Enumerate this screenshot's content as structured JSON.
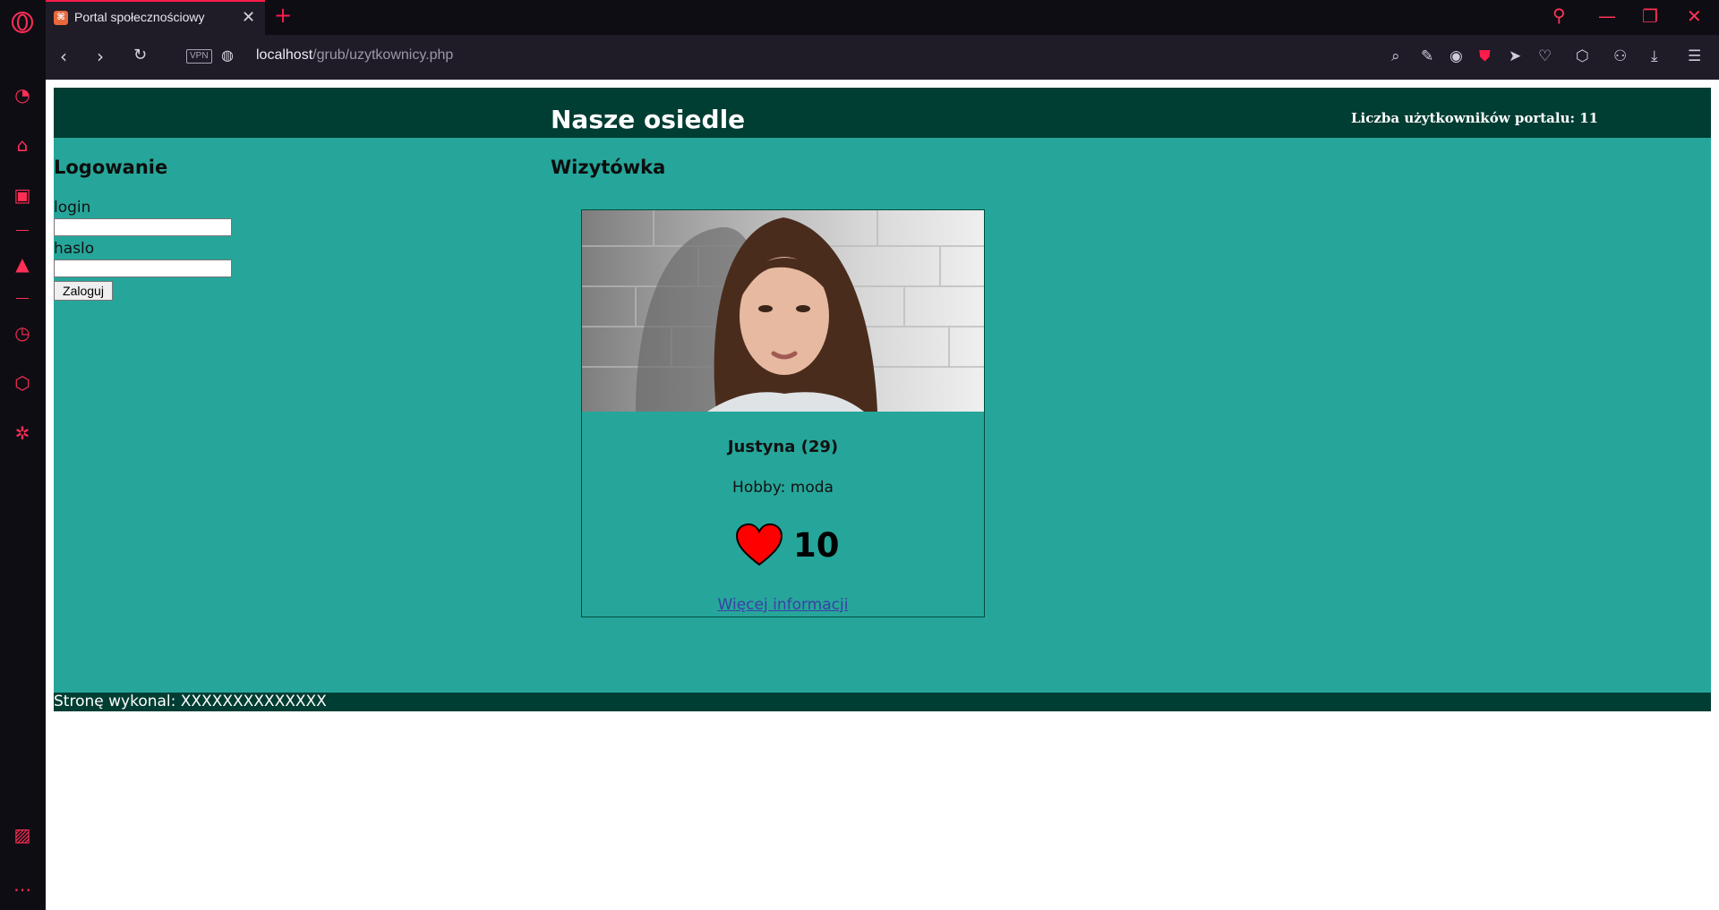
{
  "browser": {
    "tab_title": "Portal społecznościowy",
    "tab_favicon": "XAMPP",
    "tab_close": "✕",
    "new_tab": "+",
    "vpn_label": "VPN",
    "url_host": "localhost",
    "url_path": "/grub/uzytkownicy.php",
    "accent_color": "#ff1b4a"
  },
  "header": {
    "title": "Nasze osiedle",
    "users_count": "Liczba użytkowników portalu: 11"
  },
  "login": {
    "title": "Logowanie",
    "login_label": "login",
    "login_value": "",
    "haslo_label": "haslo",
    "haslo_value": "",
    "button_label": "Zaloguj"
  },
  "card": {
    "section_title": "Wizytówka",
    "name": "Justyna (29)",
    "hobby": "Hobby: moda",
    "likes": "10",
    "more_link": "Więcej informacji",
    "photo_icon": "profile-photo"
  },
  "footer": {
    "text": "Stronę wykonal: XXXXXXXXXXXXXX"
  },
  "colors": {
    "header_bg": "#003d33",
    "content_bg": "#26a69a",
    "heart": "#ff0000"
  }
}
